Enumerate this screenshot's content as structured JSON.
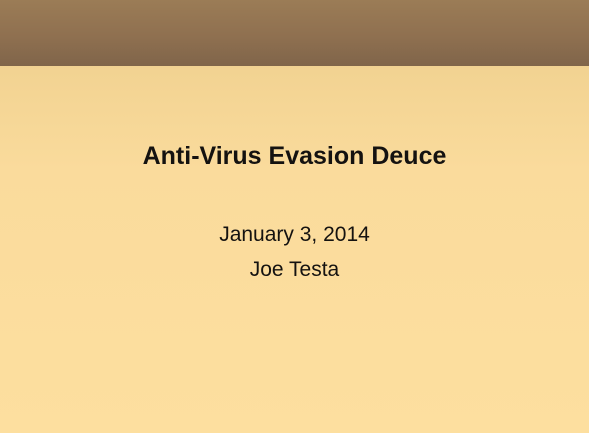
{
  "slide": {
    "title": "Anti-Virus Evasion Deuce",
    "date": "January 3, 2014",
    "author": "Joe Testa"
  },
  "colors": {
    "header_band": "#8f7050",
    "background_top": "#f2d392",
    "background_bottom": "#fddf9f",
    "text": "#141210"
  }
}
